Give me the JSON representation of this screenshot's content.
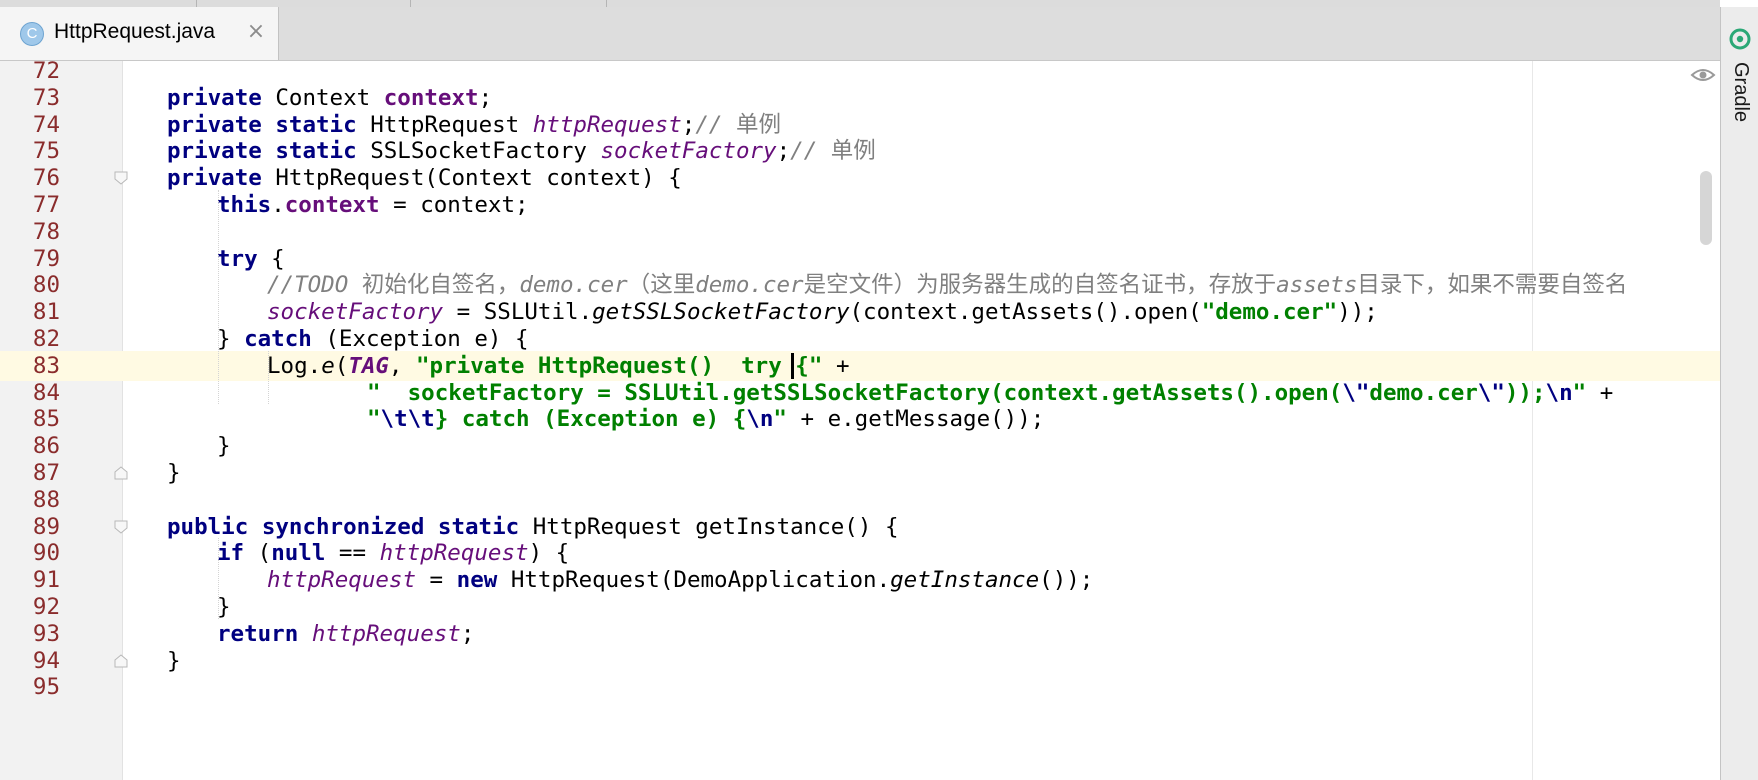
{
  "tab": {
    "icon_letter": "C",
    "title": "HttpRequest.java",
    "close_glyph": "×"
  },
  "side_panel": {
    "label": "Gradle",
    "icon": "gradle-elephant-icon"
  },
  "editor": {
    "current_line": 83,
    "icons": [
      "eye-icon",
      "fold-marker-icon"
    ],
    "colors": {
      "keyword": "#000080",
      "field": "#660e7a",
      "string": "#008000",
      "comment": "#808080",
      "line_number": "#8a2c2c",
      "current_line_bg": "#fffae3"
    },
    "lines": [
      {
        "n": "72",
        "indent": 0,
        "fold": "",
        "tokens": []
      },
      {
        "n": "73",
        "indent": 1,
        "fold": "",
        "tokens": [
          {
            "t": "private",
            "c": "kw"
          },
          {
            "t": " Context ",
            "c": ""
          },
          {
            "t": "context",
            "c": "fld"
          },
          {
            "t": ";",
            "c": ""
          }
        ]
      },
      {
        "n": "74",
        "indent": 1,
        "fold": "",
        "tokens": [
          {
            "t": "private static",
            "c": "kw"
          },
          {
            "t": " HttpRequest ",
            "c": ""
          },
          {
            "t": "httpRequest",
            "c": "sfld"
          },
          {
            "t": ";",
            "c": ""
          },
          {
            "t": "// ",
            "c": "cmt"
          },
          {
            "t": "单例",
            "c": "cmt-cjk"
          }
        ]
      },
      {
        "n": "75",
        "indent": 1,
        "fold": "",
        "tokens": [
          {
            "t": "private static",
            "c": "kw"
          },
          {
            "t": " SSLSocketFactory ",
            "c": ""
          },
          {
            "t": "socketFactory",
            "c": "sfld"
          },
          {
            "t": ";",
            "c": ""
          },
          {
            "t": "// ",
            "c": "cmt"
          },
          {
            "t": "单例",
            "c": "cmt-cjk"
          }
        ]
      },
      {
        "n": "76",
        "indent": 1,
        "fold": "open",
        "tokens": [
          {
            "t": "private",
            "c": "kw"
          },
          {
            "t": " HttpRequest(Context context) {",
            "c": ""
          }
        ]
      },
      {
        "n": "77",
        "indent": 2,
        "fold": "",
        "tokens": [
          {
            "t": "this",
            "c": "kw"
          },
          {
            "t": ".",
            "c": ""
          },
          {
            "t": "context",
            "c": "fld"
          },
          {
            "t": " = context;",
            "c": ""
          }
        ]
      },
      {
        "n": "78",
        "indent": 0,
        "fold": "",
        "tokens": []
      },
      {
        "n": "79",
        "indent": 2,
        "fold": "",
        "tokens": [
          {
            "t": "try",
            "c": "kw"
          },
          {
            "t": " {",
            "c": ""
          }
        ]
      },
      {
        "n": "80",
        "indent": 3,
        "fold": "",
        "tokens": [
          {
            "t": "//TODO ",
            "c": "cmt"
          },
          {
            "t": "初始化自签名，",
            "c": "cmt-cjk"
          },
          {
            "t": "demo.cer",
            "c": "cmt"
          },
          {
            "t": "（这里",
            "c": "cmt-cjk"
          },
          {
            "t": "demo.cer",
            "c": "cmt"
          },
          {
            "t": "是空文件）为服务器生成的自签名证书，存放于",
            "c": "cmt-cjk"
          },
          {
            "t": "assets",
            "c": "cmt"
          },
          {
            "t": "目录下，如果不需要自签名",
            "c": "cmt-cjk"
          }
        ]
      },
      {
        "n": "81",
        "indent": 3,
        "fold": "",
        "tokens": [
          {
            "t": "socketFactory",
            "c": "sfld"
          },
          {
            "t": " = SSLUtil.",
            "c": ""
          },
          {
            "t": "getSSLSocketFactory",
            "c": "smc"
          },
          {
            "t": "(context.getAssets().open(",
            "c": ""
          },
          {
            "t": "\"demo.cer\"",
            "c": "str"
          },
          {
            "t": "));",
            "c": ""
          }
        ]
      },
      {
        "n": "82",
        "indent": 2,
        "fold": "",
        "tokens": [
          {
            "t": "} ",
            "c": ""
          },
          {
            "t": "catch",
            "c": "kw"
          },
          {
            "t": " (Exception e) {",
            "c": ""
          }
        ]
      },
      {
        "n": "83",
        "indent": 3,
        "fold": "",
        "tokens": [
          {
            "t": "Log.",
            "c": ""
          },
          {
            "t": "e",
            "c": "smc"
          },
          {
            "t": "(",
            "c": ""
          },
          {
            "t": "TAG",
            "c": "sfb"
          },
          {
            "t": ", ",
            "c": ""
          },
          {
            "t": "\"private HttpRequest()  try {\" ",
            "c": "str"
          },
          {
            "t": "+",
            "c": ""
          }
        ]
      },
      {
        "n": "84",
        "indent": 5,
        "fold": "",
        "tokens": [
          {
            "t": "\"  socketFactory = SSLUtil.getSSLSocketFactory(context.getAssets().open(",
            "c": "str"
          },
          {
            "t": "\\\"",
            "c": "esc"
          },
          {
            "t": "demo.cer",
            "c": "str"
          },
          {
            "t": "\\\"",
            "c": "esc"
          },
          {
            "t": "));",
            "c": "str"
          },
          {
            "t": "\\n",
            "c": "esc"
          },
          {
            "t": "\"",
            "c": "str"
          },
          {
            "t": " +",
            "c": ""
          }
        ]
      },
      {
        "n": "85",
        "indent": 5,
        "fold": "",
        "tokens": [
          {
            "t": "\"",
            "c": "str"
          },
          {
            "t": "\\t\\t",
            "c": "esc"
          },
          {
            "t": "} catch (Exception e) {",
            "c": "str"
          },
          {
            "t": "\\n",
            "c": "esc"
          },
          {
            "t": "\"",
            "c": "str"
          },
          {
            "t": " + e.getMessage());",
            "c": ""
          }
        ]
      },
      {
        "n": "86",
        "indent": 2,
        "fold": "",
        "tokens": [
          {
            "t": "}",
            "c": ""
          }
        ]
      },
      {
        "n": "87",
        "indent": 1,
        "fold": "close",
        "tokens": [
          {
            "t": "}",
            "c": ""
          }
        ]
      },
      {
        "n": "88",
        "indent": 0,
        "fold": "",
        "tokens": []
      },
      {
        "n": "89",
        "indent": 1,
        "fold": "open",
        "tokens": [
          {
            "t": "public synchronized static",
            "c": "kw"
          },
          {
            "t": " HttpRequest getInstance() {",
            "c": ""
          }
        ]
      },
      {
        "n": "90",
        "indent": 2,
        "fold": "",
        "tokens": [
          {
            "t": "if",
            "c": "kw"
          },
          {
            "t": " (",
            "c": ""
          },
          {
            "t": "null",
            "c": "kw"
          },
          {
            "t": " == ",
            "c": ""
          },
          {
            "t": "httpRequest",
            "c": "sfld"
          },
          {
            "t": ") {",
            "c": ""
          }
        ]
      },
      {
        "n": "91",
        "indent": 3,
        "fold": "",
        "tokens": [
          {
            "t": "httpRequest",
            "c": "sfld"
          },
          {
            "t": " = ",
            "c": ""
          },
          {
            "t": "new",
            "c": "kw"
          },
          {
            "t": " HttpRequest(DemoApplication.",
            "c": ""
          },
          {
            "t": "getInstance",
            "c": "smc"
          },
          {
            "t": "());",
            "c": ""
          }
        ]
      },
      {
        "n": "92",
        "indent": 2,
        "fold": "",
        "tokens": [
          {
            "t": "}",
            "c": ""
          }
        ]
      },
      {
        "n": "93",
        "indent": 2,
        "fold": "",
        "tokens": [
          {
            "t": "return",
            "c": "kw"
          },
          {
            "t": " ",
            "c": ""
          },
          {
            "t": "httpRequest",
            "c": "sfld"
          },
          {
            "t": ";",
            "c": ""
          }
        ]
      },
      {
        "n": "94",
        "indent": 1,
        "fold": "close",
        "tokens": [
          {
            "t": "}",
            "c": ""
          }
        ]
      },
      {
        "n": "95",
        "indent": 0,
        "fold": "",
        "tokens": []
      }
    ]
  }
}
